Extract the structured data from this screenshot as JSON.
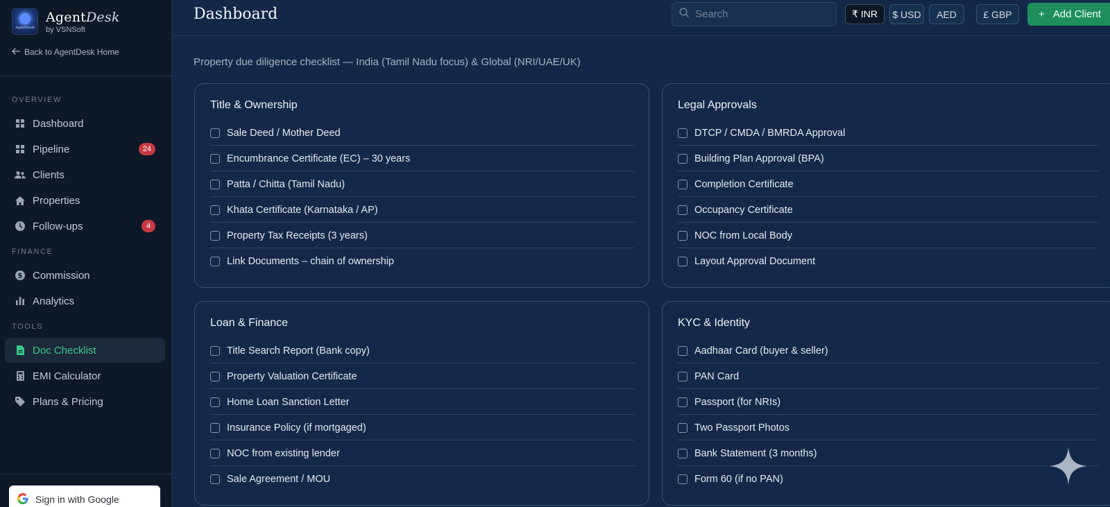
{
  "brand": {
    "name_part1": "Agent",
    "name_part2": "Desk",
    "sub": "by VSNSoft",
    "logo_text": "AgentDesk"
  },
  "back_link": "Back to AgentDesk Home",
  "sidebar": {
    "sections": [
      {
        "label": "OVERVIEW"
      },
      {
        "label": "FINANCE"
      },
      {
        "label": "TOOLS"
      }
    ],
    "items": [
      {
        "label": "Dashboard",
        "icon": "grid-icon"
      },
      {
        "label": "Pipeline",
        "icon": "grid-icon",
        "badge": "24"
      },
      {
        "label": "Clients",
        "icon": "users-icon"
      },
      {
        "label": "Properties",
        "icon": "home-icon"
      },
      {
        "label": "Follow-ups",
        "icon": "clock-icon",
        "badge": "4"
      },
      {
        "label": "Commission",
        "icon": "dollar-icon"
      },
      {
        "label": "Analytics",
        "icon": "bar-chart-icon"
      },
      {
        "label": "Doc Checklist",
        "icon": "document-icon",
        "active": true
      },
      {
        "label": "EMI Calculator",
        "icon": "calculator-icon"
      },
      {
        "label": "Plans & Pricing",
        "icon": "tag-icon"
      }
    ],
    "google_signin": "Sign in with Google"
  },
  "header": {
    "title": "Dashboard",
    "search_placeholder": "Search",
    "currencies": [
      {
        "label": "₹ INR",
        "active": true
      },
      {
        "label": "$ USD",
        "active": false
      },
      {
        "label": "AED",
        "active": false
      },
      {
        "label": "£ GBP",
        "active": false
      }
    ],
    "add_client": "Add Client"
  },
  "main": {
    "subtitle": "Property due diligence checklist — India (Tamil Nadu focus) & Global (NRI/UAE/UK)",
    "cards": [
      {
        "title": "Title & Ownership",
        "items": [
          "Sale Deed / Mother Deed",
          "Encumbrance Certificate (EC) – 30 years",
          "Patta / Chitta (Tamil Nadu)",
          "Khata Certificate (Karnataka / AP)",
          "Property Tax Receipts (3 years)",
          "Link Documents – chain of ownership"
        ]
      },
      {
        "title": "Legal Approvals",
        "items": [
          "DTCP / CMDA / BMRDA Approval",
          "Building Plan Approval (BPA)",
          "Completion Certificate",
          "Occupancy Certificate",
          "NOC from Local Body",
          "Layout Approval Document"
        ]
      },
      {
        "title": "Loan & Finance",
        "items": [
          "Title Search Report (Bank copy)",
          "Property Valuation Certificate",
          "Home Loan Sanction Letter",
          "Insurance Policy (if mortgaged)",
          "NOC from existing lender",
          "Sale Agreement / MOU"
        ]
      },
      {
        "title": "KYC & Identity",
        "items": [
          "Aadhaar Card (buyer & seller)",
          "PAN Card",
          "Passport (for NRIs)",
          "Two Passport Photos",
          "Bank Statement (3 months)",
          "Form 60 (if no PAN)"
        ]
      }
    ]
  },
  "colors": {
    "accent_green": "#35c98a",
    "add_button": "#1f8e5e",
    "badge_red": "#c83a45",
    "page_bg": "#132848",
    "sidebar_bg": "#0e1827"
  }
}
